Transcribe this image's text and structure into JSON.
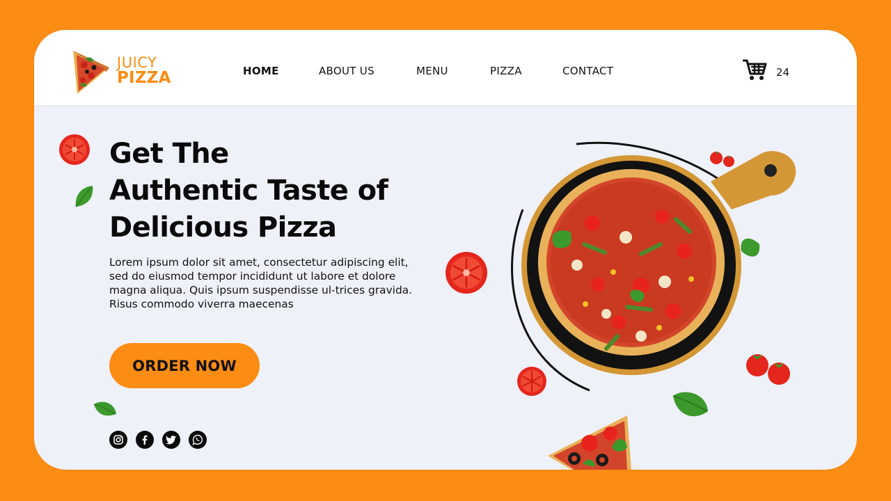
{
  "brand": {
    "line1": "JUICY",
    "line2": "PIZZA",
    "accent_color": "#fb8c14",
    "icon": "pizza-slice-icon"
  },
  "nav": {
    "items": [
      {
        "label": "HOME",
        "active": true
      },
      {
        "label": "ABOUT US",
        "active": false
      },
      {
        "label": "MENU",
        "active": false
      },
      {
        "label": "PIZZA",
        "active": false
      },
      {
        "label": "CONTACT",
        "active": false
      }
    ]
  },
  "cart": {
    "icon": "cart-icon",
    "count": "24"
  },
  "hero": {
    "title_lines": [
      "Get The",
      "Authentic Taste of",
      "Delicious Pizza"
    ],
    "body": "Lorem ipsum dolor sit amet, consectetur adipiscing elit, sed do eiusmod tempor incididunt ut labore et dolore magna aliqua. Quis ipsum suspendisse ul-trices gravida. Risus commodo viverra maecenas",
    "cta": "ORDER NOW"
  },
  "socials": [
    {
      "icon": "instagram-icon"
    },
    {
      "icon": "facebook-icon"
    },
    {
      "icon": "twitter-icon"
    },
    {
      "icon": "whatsapp-icon"
    }
  ],
  "colors": {
    "background": "#fb8c14",
    "card": "#eff1f8",
    "text": "#0a0a0a"
  }
}
